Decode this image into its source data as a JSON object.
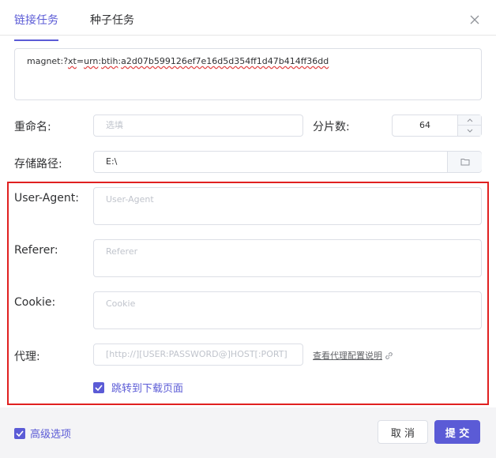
{
  "tabs": [
    {
      "label": "链接任务",
      "active": true
    },
    {
      "label": "种子任务",
      "active": false
    }
  ],
  "magnet": {
    "prefix": "magnet:?",
    "xt_key": "xt",
    "eq": "=",
    "urn": "urn",
    "sep1": ":",
    "btih": "btih",
    "sep2": ":",
    "hash": "a2d07b599126ef7e16d5d354ff1d47b414ff36dd"
  },
  "rename": {
    "label": "重命名:",
    "placeholder": "选填"
  },
  "split": {
    "label": "分片数:",
    "value": "64"
  },
  "path": {
    "label": "存储路径:",
    "value": "E:\\"
  },
  "advanced": {
    "user_agent": {
      "label": "User-Agent:",
      "placeholder": "User-Agent"
    },
    "referer": {
      "label": "Referer:",
      "placeholder": "Referer"
    },
    "cookie": {
      "label": "Cookie:",
      "placeholder": "Cookie"
    },
    "proxy": {
      "label": "代理:",
      "placeholder": "[http://][USER:PASSWORD@]HOST[:PORT]",
      "help_link": "查看代理配置说明"
    },
    "jump_checkbox": {
      "label": "跳转到下载页面",
      "checked": true
    }
  },
  "footer": {
    "advanced_toggle": {
      "label": "高级选项",
      "checked": true
    },
    "cancel_label": "取 消",
    "submit_label": "提 交"
  },
  "colors": {
    "accent": "#5b5bd6",
    "highlight_border": "#e02020"
  }
}
